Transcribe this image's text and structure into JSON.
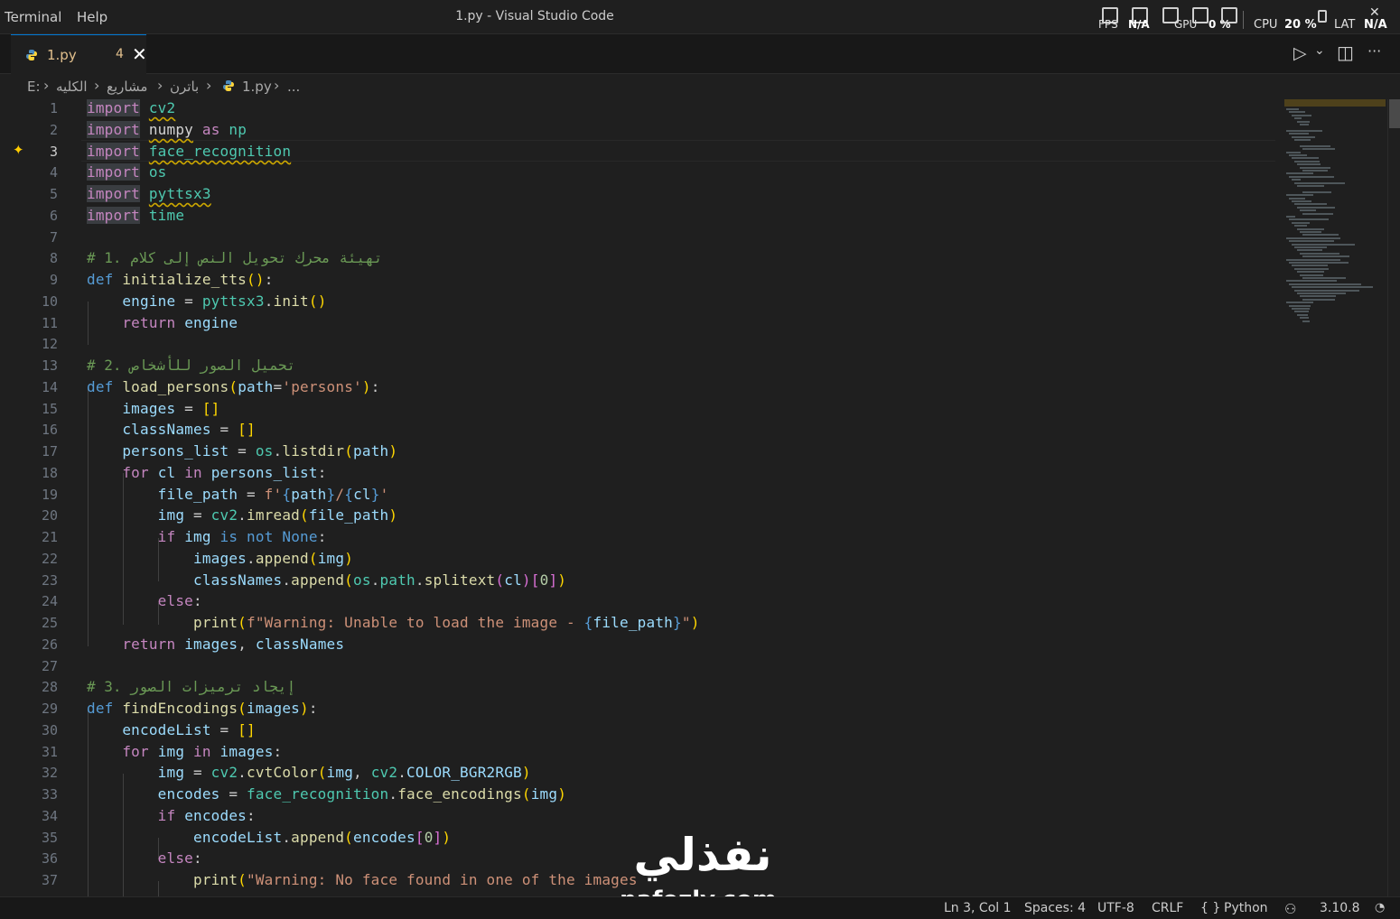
{
  "menu": {
    "items": [
      "Terminal",
      "Help"
    ]
  },
  "window": {
    "title": "1.py - Visual Studio Code"
  },
  "perf_overlay": {
    "fps_label": "FPS",
    "fps_value": "N/A",
    "gpu_label": "GPU",
    "gpu_value": "0 %",
    "cpu_label": "CPU",
    "cpu_value": "20 %",
    "lat_label": "LAT",
    "lat_value": "N/A"
  },
  "tab": {
    "label": "1.py",
    "problems": "4",
    "close": "✕",
    "icon": "python-file-icon"
  },
  "editor_actions": {
    "run": "▷",
    "run_menu": "⌄",
    "split": "◫",
    "more": "···"
  },
  "breadcrumb": {
    "drive": "E:",
    "folder1": "الكليه",
    "folder2": "مشاريع",
    "folder3": "باترن",
    "file": "1.py",
    "symbol": "..."
  },
  "editor": {
    "current_line": 3,
    "line_numbers": [
      "1",
      "2",
      "3",
      "4",
      "5",
      "6",
      "7",
      "8",
      "9",
      "10",
      "11",
      "12",
      "13",
      "14",
      "15",
      "16",
      "17",
      "18",
      "19",
      "20",
      "21",
      "22",
      "23",
      "24",
      "25",
      "26",
      "27",
      "28",
      "29",
      "30",
      "31",
      "32",
      "33",
      "34",
      "35",
      "36",
      "37"
    ],
    "tokens": {
      "import": "import",
      "as": "as",
      "def": "def",
      "return": "return",
      "for": "for",
      "in": "in",
      "if": "if",
      "is": "is",
      "not": "not",
      "none": "None",
      "else": "else",
      "cv2": "cv2",
      "numpy": "numpy",
      "np": "np",
      "face_recognition": "face_recognition",
      "os": "os",
      "pyttsx3": "pyttsx3",
      "time": "time",
      "comment1": "# 1. تهيئة محرك تحويل النص إلى كلام",
      "initialize_tts": "initialize_tts",
      "engine": "engine",
      "init": "init",
      "comment2": "# 2. تحميل الصور للأشخاص",
      "load_persons": "load_persons",
      "path": "path",
      "persons_str": "'persons'",
      "images": "images",
      "classNames": "classNames",
      "persons_list": "persons_list",
      "listdir": "listdir",
      "cl": "cl",
      "file_path": "file_path",
      "fstr_prefix": "f'",
      "fstr_sep": "/",
      "fstr_end": "'",
      "img": "img",
      "imread": "imread",
      "append": "append",
      "path_attr": "path",
      "splitext": "splitext",
      "zero": "0",
      "print": "print",
      "warn1_prefix": "f\"Warning: Unable to load the image - ",
      "warn1_end": "\"",
      "comment3": "# 3. إيجاد ترميزات الصور",
      "findEncodings": "findEncodings",
      "encodeList": "encodeList",
      "cvtColor": "cvtColor",
      "color_const": "COLOR_BGR2RGB",
      "encodes": "encodes",
      "face_encodings": "face_encodings",
      "warn2": "\"Warning: No face found in one of the images"
    }
  },
  "status": {
    "position": "Ln 3, Col 1",
    "spaces": "Spaces: 4",
    "encoding": "UTF-8",
    "eol": "CRLF",
    "braces": "{ }",
    "language": "Python",
    "python_version": "3.10.8",
    "bell": "🔔"
  },
  "watermark": {
    "arabic": "نفذلي",
    "latin": "nafezly.com"
  }
}
